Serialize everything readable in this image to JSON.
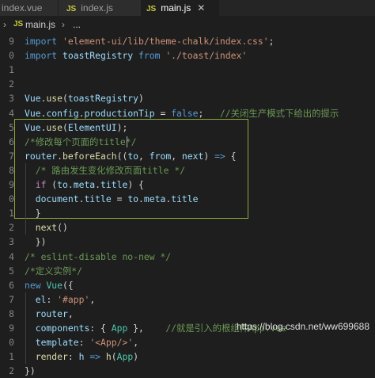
{
  "tabs": [
    {
      "name": "index.vue",
      "active": false
    },
    {
      "name": "index.js",
      "active": false
    },
    {
      "name": "main.js",
      "active": true
    }
  ],
  "tab_icon_text": "JS",
  "breadcrumb": {
    "file": "main.js",
    "ellipsis": "..."
  },
  "code_lines": [
    {
      "n": "9",
      "tokens": [
        [
          "kw",
          "import"
        ],
        [
          "pun",
          " "
        ],
        [
          "str",
          "'element-ui/lib/theme-chalk/index.css'"
        ],
        [
          "pun",
          ";"
        ]
      ]
    },
    {
      "n": "0",
      "tokens": [
        [
          "kw",
          "import"
        ],
        [
          "pun",
          " "
        ],
        [
          "id",
          "toastRegistry"
        ],
        [
          "pun",
          " "
        ],
        [
          "kw",
          "from"
        ],
        [
          "pun",
          " "
        ],
        [
          "str",
          "'./toast/index'"
        ]
      ]
    },
    {
      "n": "1",
      "tokens": []
    },
    {
      "n": "2",
      "tokens": []
    },
    {
      "n": "3",
      "tokens": [
        [
          "id",
          "Vue"
        ],
        [
          "pun",
          "."
        ],
        [
          "fn",
          "use"
        ],
        [
          "pun",
          "("
        ],
        [
          "id",
          "toastRegistry"
        ],
        [
          "pun",
          ")"
        ]
      ]
    },
    {
      "n": "4",
      "tokens": [
        [
          "id",
          "Vue"
        ],
        [
          "pun",
          "."
        ],
        [
          "id",
          "config"
        ],
        [
          "pun",
          "."
        ],
        [
          "id",
          "productionTip"
        ],
        [
          "pun",
          " = "
        ],
        [
          "kw",
          "false"
        ],
        [
          "pun",
          ";   "
        ],
        [
          "cmt",
          "//关闭生产模式下给出的提示"
        ]
      ]
    },
    {
      "n": "5",
      "tokens": [
        [
          "id",
          "Vue"
        ],
        [
          "pun",
          "."
        ],
        [
          "fn",
          "use"
        ],
        [
          "pun",
          "("
        ],
        [
          "id",
          "ElementUI"
        ],
        [
          "pun",
          ");"
        ]
      ]
    },
    {
      "n": "6",
      "tokens": [
        [
          "cmt",
          "/*修改每个页面的title*/"
        ]
      ]
    },
    {
      "n": "7",
      "tokens": [
        [
          "id",
          "router"
        ],
        [
          "pun",
          "."
        ],
        [
          "fn",
          "beforeEach"
        ],
        [
          "pun",
          "(("
        ],
        [
          "id",
          "to"
        ],
        [
          "pun",
          ", "
        ],
        [
          "id",
          "from"
        ],
        [
          "pun",
          ", "
        ],
        [
          "id",
          "next"
        ],
        [
          "pun",
          ") "
        ],
        [
          "kw",
          "=>"
        ],
        [
          "pun",
          " {"
        ]
      ]
    },
    {
      "n": "8",
      "tokens": [
        [
          "pun",
          "  "
        ],
        [
          "cmt",
          "/* 路由发生变化修改页面title */"
        ]
      ]
    },
    {
      "n": "9",
      "tokens": [
        [
          "pun",
          "  "
        ],
        [
          "ctl",
          "if"
        ],
        [
          "pun",
          " ("
        ],
        [
          "id",
          "to"
        ],
        [
          "pun",
          "."
        ],
        [
          "id",
          "meta"
        ],
        [
          "pun",
          "."
        ],
        [
          "id",
          "title"
        ],
        [
          "pun",
          ") {"
        ]
      ]
    },
    {
      "n": "0",
      "tokens": [
        [
          "pun",
          "  "
        ],
        [
          "id",
          "document"
        ],
        [
          "pun",
          "."
        ],
        [
          "id",
          "title"
        ],
        [
          "pun",
          " = "
        ],
        [
          "id",
          "to"
        ],
        [
          "pun",
          "."
        ],
        [
          "id",
          "meta"
        ],
        [
          "pun",
          "."
        ],
        [
          "id",
          "title"
        ]
      ]
    },
    {
      "n": "1",
      "tokens": [
        [
          "pun",
          "  }"
        ]
      ]
    },
    {
      "n": "2",
      "tokens": [
        [
          "pun",
          "  "
        ],
        [
          "fn",
          "next"
        ],
        [
          "pun",
          "()"
        ]
      ]
    },
    {
      "n": "3",
      "tokens": [
        [
          "pun",
          "  })"
        ]
      ]
    },
    {
      "n": "4",
      "tokens": [
        [
          "cmt",
          "/* eslint-disable no-new */"
        ]
      ]
    },
    {
      "n": "5",
      "tokens": [
        [
          "cmt",
          "/*定义实例*/"
        ]
      ]
    },
    {
      "n": "6",
      "tokens": [
        [
          "kw",
          "new"
        ],
        [
          "pun",
          " "
        ],
        [
          "cls",
          "Vue"
        ],
        [
          "pun",
          "({"
        ]
      ]
    },
    {
      "n": "7",
      "tokens": [
        [
          "pun",
          "  "
        ],
        [
          "id",
          "el"
        ],
        [
          "pun",
          ": "
        ],
        [
          "str",
          "'#app'"
        ],
        [
          "pun",
          ","
        ]
      ]
    },
    {
      "n": "8",
      "tokens": [
        [
          "pun",
          "  "
        ],
        [
          "id",
          "router"
        ],
        [
          "pun",
          ","
        ]
      ]
    },
    {
      "n": "9",
      "tokens": [
        [
          "pun",
          "  "
        ],
        [
          "id",
          "components"
        ],
        [
          "pun",
          ": { "
        ],
        [
          "cls",
          "App"
        ],
        [
          "pun",
          " },    "
        ],
        [
          "cmt",
          "//就是引入的根组件App.vue"
        ]
      ]
    },
    {
      "n": "0",
      "tokens": [
        [
          "pun",
          "  "
        ],
        [
          "id",
          "template"
        ],
        [
          "pun",
          ": "
        ],
        [
          "str",
          "'<App/>'"
        ],
        [
          "pun",
          ","
        ]
      ]
    },
    {
      "n": "1",
      "tokens": [
        [
          "pun",
          "  "
        ],
        [
          "fn",
          "render"
        ],
        [
          "pun",
          ": "
        ],
        [
          "id",
          "h"
        ],
        [
          "pun",
          " "
        ],
        [
          "kw",
          "=>"
        ],
        [
          "pun",
          " "
        ],
        [
          "fn",
          "h"
        ],
        [
          "pun",
          "("
        ],
        [
          "cls",
          "App"
        ],
        [
          "pun",
          ")"
        ]
      ]
    },
    {
      "n": "2",
      "tokens": [
        [
          "pun",
          "})"
        ]
      ]
    }
  ],
  "watermark": "https://blog.csdn.net/ww699688",
  "colors": {
    "editor_bg": "#1e1e1e",
    "highlight_border": "#8ba93a",
    "js_icon": "#cbcb41"
  }
}
